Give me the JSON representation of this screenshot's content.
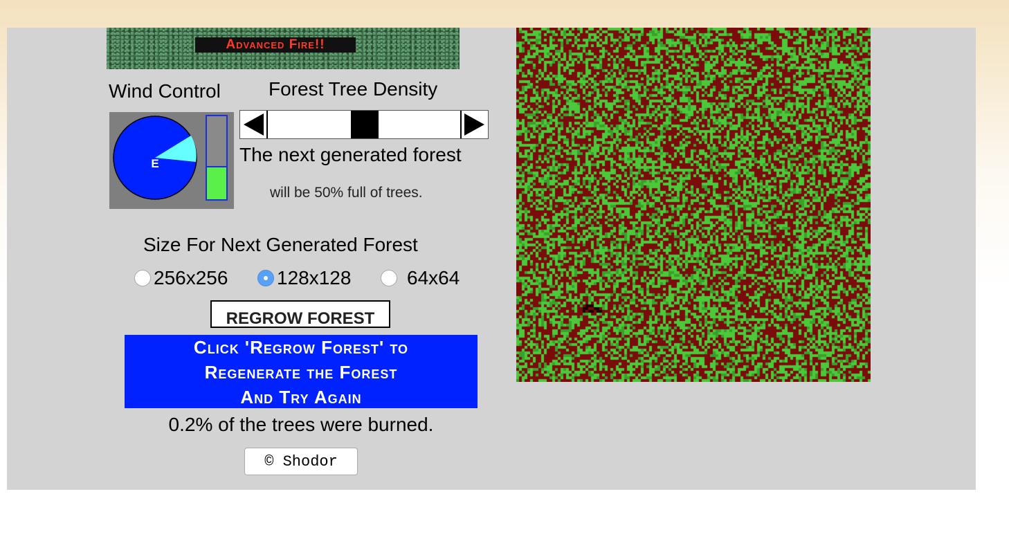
{
  "banner": {
    "title": "Advanced Fire!!"
  },
  "wind": {
    "label": "Wind Control",
    "direction": "E",
    "strength_fraction": 0.4,
    "colors": {
      "compass": "#0022ff",
      "pointer": "#66ffff",
      "bar_fill": "#5bf049"
    }
  },
  "density": {
    "label": "Forest Tree Density",
    "value_percent": 50,
    "line1": "The next generated forest",
    "line2": "will be 50% full of trees."
  },
  "size": {
    "label": "Size For Next Generated Forest",
    "options": [
      {
        "label": "256x256",
        "selected": false
      },
      {
        "label": "128x128",
        "selected": true
      },
      {
        "label": "64x64",
        "selected": false
      }
    ]
  },
  "regrow_button": {
    "label": "REGROW FOREST"
  },
  "message": {
    "lines": [
      "Click 'Regrow Forest' to",
      "Regenerate the Forest",
      "And Try Again"
    ],
    "background": "#0022ff"
  },
  "status": {
    "burned_text": "0.2% of the trees were burned."
  },
  "footer": {
    "copyright_button": "© Shodor"
  },
  "forest": {
    "grid_cells": 128,
    "tree_density": 0.5,
    "colors": {
      "tree": "#4cc93a",
      "tree_dark": "#3aa02c",
      "ground": "#7a0c0c",
      "burned": "#1a0000"
    }
  }
}
